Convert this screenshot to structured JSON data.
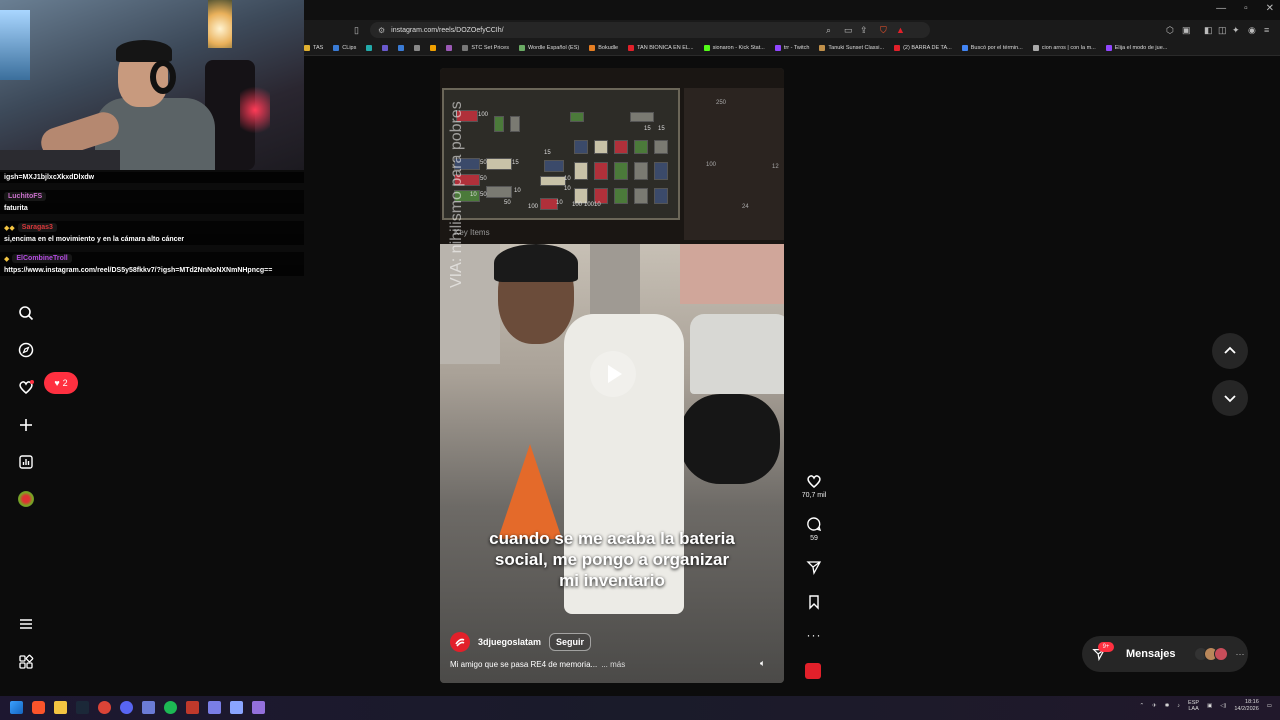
{
  "browser": {
    "url": "instagram.com/reels/DOZOefyCCIh/",
    "bookmarks": [
      {
        "label": "TAS",
        "color": "#e0b030"
      },
      {
        "label": "CLips",
        "color": "#3a7bd5"
      },
      {
        "label": "",
        "color": "#2aa"
      },
      {
        "label": "",
        "color": "#6a5acd"
      },
      {
        "label": "",
        "color": "#3a7bd5"
      },
      {
        "label": "",
        "color": "#888"
      },
      {
        "label": "",
        "color": "#f0a000"
      },
      {
        "label": "",
        "color": "#9b59b6"
      },
      {
        "label": "STC Set Prices",
        "color": "#777"
      },
      {
        "label": "Wordle Español (ES)",
        "color": "#6aaa64"
      },
      {
        "label": "Bokudle",
        "color": "#e67e22"
      },
      {
        "label": "TAN BIONICA EN EL...",
        "color": "#e2202a"
      },
      {
        "label": "sionaron - Kick Stat...",
        "color": "#53fc18"
      },
      {
        "label": "trr - Twitch",
        "color": "#9146ff"
      },
      {
        "label": "Tanuki Sunset Classi...",
        "color": "#c0904a"
      },
      {
        "label": "(2) BARRA DE TA...",
        "color": "#e2202a"
      },
      {
        "label": "Buscó por el términ...",
        "color": "#4285f4"
      },
      {
        "label": "cion arros | con la m...",
        "color": "#aaa"
      },
      {
        "label": "Elija el modo de jue...",
        "color": "#9146ff"
      }
    ]
  },
  "chat": [
    {
      "type": "text",
      "text": "igsh=MXJ1bjlxcXkxdDlxdw"
    },
    {
      "type": "user",
      "name": "LuchitoFS",
      "color": "#c86fc9",
      "badge": ""
    },
    {
      "type": "text",
      "text": "faturita"
    },
    {
      "type": "user",
      "name": "Saragas3",
      "color": "#d9383a",
      "badge": "◆◆"
    },
    {
      "type": "text",
      "text": "si,encima en el movimiento y en la cámara alto cáncer"
    },
    {
      "type": "user",
      "name": "ElCombineTroll",
      "color": "#b44be1",
      "badge": "◆"
    },
    {
      "type": "text",
      "text": "https://www.instagram.com/reel/DS5y58fkkv7/?igsh=MTd2NnNoNXNmNHpncg=="
    }
  ],
  "sidebar": {
    "icons": [
      "search-icon",
      "explore-icon",
      "notifications-heart-icon",
      "create-plus-icon",
      "dashboard-icon",
      "profile-avatar"
    ],
    "notification_count": "2",
    "menu_icons": [
      "more-menu-icon",
      "also-from-meta-icon"
    ]
  },
  "reel": {
    "watermark": "VIA: nihilismo para pobres",
    "inventory_label": "Key Items",
    "inventory_numbers": [
      "100",
      "15",
      "15",
      "50",
      "50",
      "15",
      "10",
      "10",
      "50",
      "15",
      "10",
      "10",
      "50",
      "10",
      "100",
      "10",
      "100",
      "100"
    ],
    "map_numbers": [
      "250",
      "100",
      "12",
      "24"
    ],
    "caption_overlay": "cuando se me acaba la bateria\nsocial, me pongo a organizar\nmi inventario",
    "account": "3djuegoslatam",
    "follow_label": "Seguir",
    "description": "Mi amigo que se pasa RE4 de memoria...",
    "more_label": "... más",
    "likes": "70,7 mil",
    "comments": "59"
  },
  "messages": {
    "label": "Mensajes",
    "badge": "9+"
  },
  "taskbar": {
    "lang_top": "ESP",
    "lang_bottom": "LAA",
    "time": "18:16",
    "date": "14/2/2026"
  },
  "colors": {
    "ig_red": "#ff3040",
    "brand_3djuegos": "#e2202a",
    "page_bg": "#0c0c0c"
  }
}
